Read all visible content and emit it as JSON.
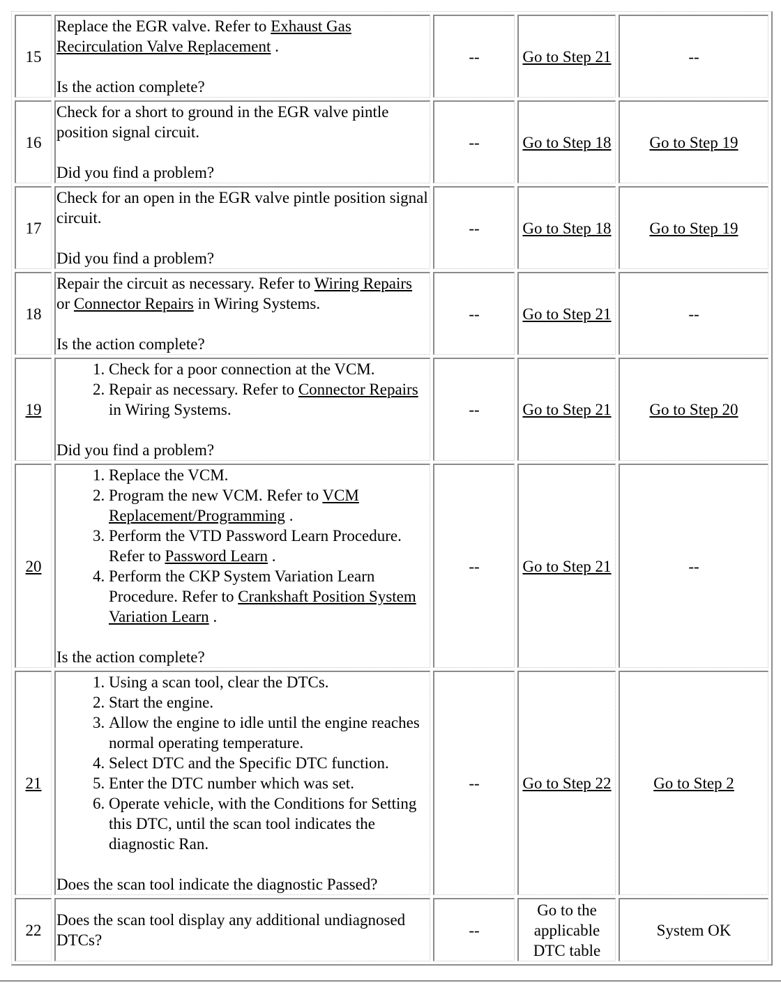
{
  "rows": [
    {
      "step": "15",
      "step_is_link": false,
      "action_parts": [
        {
          "text": "Replace the EGR valve. Refer to "
        },
        {
          "text": "Exhaust Gas Recirculation Valve Replacement",
          "link": true
        },
        {
          "text": " ."
        }
      ],
      "question": "Is the action complete?",
      "value": "--",
      "yes": {
        "text": "Go to Step 21",
        "link": true
      },
      "no": {
        "text": "--",
        "link": false
      }
    },
    {
      "step": "16",
      "step_is_link": false,
      "action_parts": [
        {
          "text": "Check for a short to ground in the EGR valve pintle position signal circuit."
        }
      ],
      "question": "Did you find a problem?",
      "value": "--",
      "yes": {
        "text": "Go to Step 18",
        "link": true
      },
      "no": {
        "text": "Go to Step 19",
        "link": true
      }
    },
    {
      "step": "17",
      "step_is_link": false,
      "action_parts": [
        {
          "text": "Check for an open in the EGR valve pintle position signal circuit."
        }
      ],
      "question": "Did you find a problem?",
      "value": "--",
      "yes": {
        "text": "Go to Step 18",
        "link": true
      },
      "no": {
        "text": "Go to Step 19",
        "link": true
      }
    },
    {
      "step": "18",
      "step_is_link": false,
      "action_parts": [
        {
          "text": "Repair the circuit as necessary. Refer to "
        },
        {
          "text": "Wiring Repairs",
          "link": true
        },
        {
          "text": " or "
        },
        {
          "text": "Connector Repairs",
          "link": true
        },
        {
          "text": " in Wiring Systems."
        }
      ],
      "question": "Is the action complete?",
      "value": "--",
      "yes": {
        "text": "Go to Step 21",
        "link": true
      },
      "no": {
        "text": "--",
        "link": false
      }
    },
    {
      "step": "19",
      "step_is_link": true,
      "list_items": [
        [
          {
            "text": "Check for a poor connection at the VCM."
          }
        ],
        [
          {
            "text": "Repair as necessary. Refer to "
          },
          {
            "text": "Connector Repairs",
            "link": true
          },
          {
            "text": " in Wiring Systems."
          }
        ]
      ],
      "question": "Did you find a problem?",
      "value": "--",
      "yes": {
        "text": "Go to Step 21",
        "link": true
      },
      "no": {
        "text": "Go to Step 20",
        "link": true
      }
    },
    {
      "step": "20",
      "step_is_link": true,
      "list_items": [
        [
          {
            "text": "Replace the VCM."
          }
        ],
        [
          {
            "text": "Program the new VCM. Refer to "
          },
          {
            "text": "VCM Replacement/Programming",
            "link": true
          },
          {
            "text": " ."
          }
        ],
        [
          {
            "text": "Perform the VTD Password Learn Procedure. Refer to "
          },
          {
            "text": "Password Learn",
            "link": true
          },
          {
            "text": " ."
          }
        ],
        [
          {
            "text": "Perform the CKP System Variation Learn Procedure. Refer to "
          },
          {
            "text": "Crankshaft Position System Variation Learn",
            "link": true
          },
          {
            "text": " ."
          }
        ]
      ],
      "question": "Is the action complete?",
      "value": "--",
      "yes": {
        "text": "Go to Step 21",
        "link": true
      },
      "no": {
        "text": "--",
        "link": false
      }
    },
    {
      "step": "21",
      "step_is_link": true,
      "list_items": [
        [
          {
            "text": "Using a scan tool, clear the DTCs."
          }
        ],
        [
          {
            "text": "Start the engine."
          }
        ],
        [
          {
            "text": "Allow the engine to idle until the engine reaches normal operating temperature."
          }
        ],
        [
          {
            "text": "Select DTC and the Specific DTC function."
          }
        ],
        [
          {
            "text": "Enter the DTC number which was set."
          }
        ],
        [
          {
            "text": "Operate vehicle, with the Conditions for Setting this DTC, until the scan tool indicates the diagnostic Ran."
          }
        ]
      ],
      "question": "Does the scan tool indicate the diagnostic Passed?",
      "value": "--",
      "yes": {
        "text": "Go to Step 22",
        "link": true
      },
      "no": {
        "text": "Go to Step 2",
        "link": true
      }
    },
    {
      "step": "22",
      "step_is_link": false,
      "action_parts": [
        {
          "text": "Does the scan tool display any additional undiagnosed DTCs?"
        }
      ],
      "question": "",
      "value": "--",
      "yes": {
        "text": "Go to the applicable DTC table",
        "link": false
      },
      "no": {
        "text": "System OK",
        "link": false
      }
    }
  ]
}
